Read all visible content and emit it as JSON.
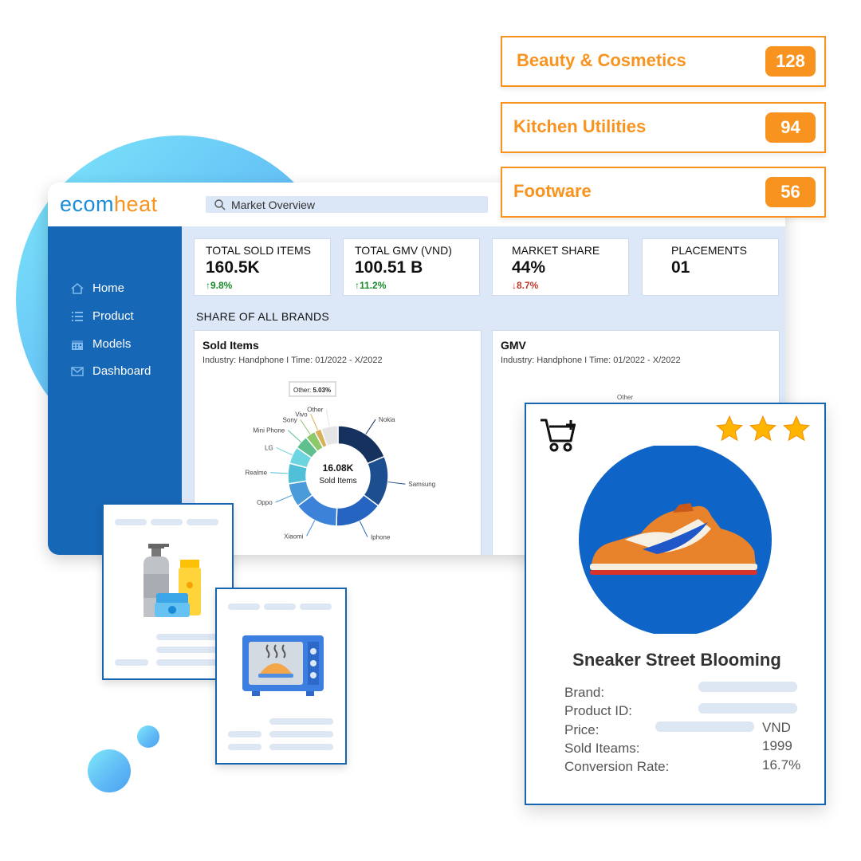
{
  "app": {
    "logo_part1": "ecom",
    "logo_part2": "heat"
  },
  "search": {
    "text": "Market Overview"
  },
  "sidebar": {
    "items": [
      {
        "label": "Home",
        "icon": "home-icon"
      },
      {
        "label": "Product",
        "icon": "list-icon"
      },
      {
        "label": "Models",
        "icon": "calendar-icon"
      },
      {
        "label": "Dashboard",
        "icon": "mail-icon"
      }
    ]
  },
  "kpis": [
    {
      "label": "TOTAL SOLD ITEMS",
      "value": "160.5K",
      "delta": "↑9.8%",
      "trend": "up"
    },
    {
      "label": "TOTAL GMV (VND)",
      "value": "100.51 B",
      "delta": "↑11.2%",
      "trend": "up"
    },
    {
      "label": "MARKET SHARE",
      "value": "44%",
      "delta": "↓8.7%",
      "trend": "down"
    },
    {
      "label": "PLACEMENTS",
      "value": "01",
      "delta": "",
      "trend": "none"
    }
  ],
  "section_title": "SHARE OF ALL BRANDS",
  "panels": [
    {
      "title": "Sold Items",
      "subtitle": "Industry: Handphone I Time: 01/2022 - X/2022"
    },
    {
      "title": "GMV",
      "subtitle": "Industry: Handphone I Time: 01/2022 - X/2022"
    }
  ],
  "chart_data": [
    {
      "type": "pie",
      "center_value": "16.08K",
      "center_label": "Sold Items",
      "tooltip": {
        "label": "Other:",
        "value": "5.03%"
      },
      "categories": [
        "Nokia",
        "Samsung",
        "Iphone",
        "Xiaomi",
        "Oppo",
        "Realme",
        "LG",
        "Mini Phone",
        "Sony",
        "Vivo",
        "Other"
      ],
      "values": [
        17,
        15,
        14,
        13,
        7,
        6,
        5,
        4,
        3,
        2,
        5.03
      ],
      "colors": [
        "#15325e",
        "#1d4e8f",
        "#2664c2",
        "#3b82d8",
        "#4a9bd9",
        "#52bfd9",
        "#6dd5df",
        "#5fbf8e",
        "#8bc96a",
        "#d9b05a",
        "#e5e5e5"
      ]
    },
    {
      "type": "pie",
      "categories": [
        "Other"
      ],
      "values": []
    }
  ],
  "categories_list": [
    {
      "label": "Beauty & Cosmetics",
      "count": "128"
    },
    {
      "label": "Kitchen Utilities",
      "count": "94"
    },
    {
      "label": "Footware",
      "count": "56"
    }
  ],
  "product": {
    "name": "Sneaker Street Blooming",
    "rating_stars": 3,
    "fields": {
      "brand": "Brand:",
      "product_id": "Product ID:",
      "price": "Price:",
      "sold": "Sold Iteams:",
      "conversion": "Conversion Rate:"
    },
    "values": {
      "price_currency": "VND",
      "sold": "1999",
      "conversion": "16.7%"
    }
  },
  "colors": {
    "accent": "#f7931e",
    "brand_blue": "#1667b6",
    "panel_bg": "#dce7f8"
  }
}
